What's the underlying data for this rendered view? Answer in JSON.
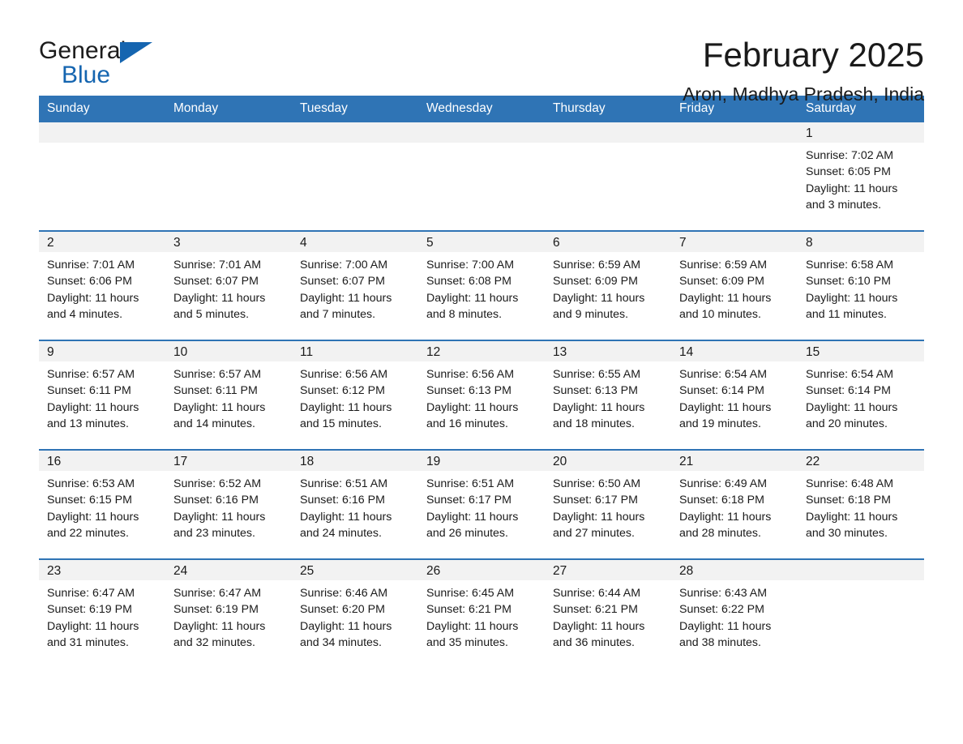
{
  "brand": {
    "name_part1": "General",
    "name_part2": "Blue",
    "triangle_icon": "triangle-icon",
    "accent_color": "#1565b0"
  },
  "header": {
    "month_title": "February 2025",
    "location": "Aron, Madhya Pradesh, India"
  },
  "theme": {
    "header_blue": "#2f74b5",
    "daynum_band": "#f2f2f2",
    "text": "#1a1a1a"
  },
  "calendar": {
    "weekday_headers": [
      "Sunday",
      "Monday",
      "Tuesday",
      "Wednesday",
      "Thursday",
      "Friday",
      "Saturday"
    ],
    "weeks": [
      [
        {
          "blank": true
        },
        {
          "blank": true
        },
        {
          "blank": true
        },
        {
          "blank": true
        },
        {
          "blank": true
        },
        {
          "blank": true
        },
        {
          "day": "1",
          "sunrise": "Sunrise: 7:02 AM",
          "sunset": "Sunset: 6:05 PM",
          "daylight1": "Daylight: 11 hours",
          "daylight2": "and 3 minutes."
        }
      ],
      [
        {
          "day": "2",
          "sunrise": "Sunrise: 7:01 AM",
          "sunset": "Sunset: 6:06 PM",
          "daylight1": "Daylight: 11 hours",
          "daylight2": "and 4 minutes."
        },
        {
          "day": "3",
          "sunrise": "Sunrise: 7:01 AM",
          "sunset": "Sunset: 6:07 PM",
          "daylight1": "Daylight: 11 hours",
          "daylight2": "and 5 minutes."
        },
        {
          "day": "4",
          "sunrise": "Sunrise: 7:00 AM",
          "sunset": "Sunset: 6:07 PM",
          "daylight1": "Daylight: 11 hours",
          "daylight2": "and 7 minutes."
        },
        {
          "day": "5",
          "sunrise": "Sunrise: 7:00 AM",
          "sunset": "Sunset: 6:08 PM",
          "daylight1": "Daylight: 11 hours",
          "daylight2": "and 8 minutes."
        },
        {
          "day": "6",
          "sunrise": "Sunrise: 6:59 AM",
          "sunset": "Sunset: 6:09 PM",
          "daylight1": "Daylight: 11 hours",
          "daylight2": "and 9 minutes."
        },
        {
          "day": "7",
          "sunrise": "Sunrise: 6:59 AM",
          "sunset": "Sunset: 6:09 PM",
          "daylight1": "Daylight: 11 hours",
          "daylight2": "and 10 minutes."
        },
        {
          "day": "8",
          "sunrise": "Sunrise: 6:58 AM",
          "sunset": "Sunset: 6:10 PM",
          "daylight1": "Daylight: 11 hours",
          "daylight2": "and 11 minutes."
        }
      ],
      [
        {
          "day": "9",
          "sunrise": "Sunrise: 6:57 AM",
          "sunset": "Sunset: 6:11 PM",
          "daylight1": "Daylight: 11 hours",
          "daylight2": "and 13 minutes."
        },
        {
          "day": "10",
          "sunrise": "Sunrise: 6:57 AM",
          "sunset": "Sunset: 6:11 PM",
          "daylight1": "Daylight: 11 hours",
          "daylight2": "and 14 minutes."
        },
        {
          "day": "11",
          "sunrise": "Sunrise: 6:56 AM",
          "sunset": "Sunset: 6:12 PM",
          "daylight1": "Daylight: 11 hours",
          "daylight2": "and 15 minutes."
        },
        {
          "day": "12",
          "sunrise": "Sunrise: 6:56 AM",
          "sunset": "Sunset: 6:13 PM",
          "daylight1": "Daylight: 11 hours",
          "daylight2": "and 16 minutes."
        },
        {
          "day": "13",
          "sunrise": "Sunrise: 6:55 AM",
          "sunset": "Sunset: 6:13 PM",
          "daylight1": "Daylight: 11 hours",
          "daylight2": "and 18 minutes."
        },
        {
          "day": "14",
          "sunrise": "Sunrise: 6:54 AM",
          "sunset": "Sunset: 6:14 PM",
          "daylight1": "Daylight: 11 hours",
          "daylight2": "and 19 minutes."
        },
        {
          "day": "15",
          "sunrise": "Sunrise: 6:54 AM",
          "sunset": "Sunset: 6:14 PM",
          "daylight1": "Daylight: 11 hours",
          "daylight2": "and 20 minutes."
        }
      ],
      [
        {
          "day": "16",
          "sunrise": "Sunrise: 6:53 AM",
          "sunset": "Sunset: 6:15 PM",
          "daylight1": "Daylight: 11 hours",
          "daylight2": "and 22 minutes."
        },
        {
          "day": "17",
          "sunrise": "Sunrise: 6:52 AM",
          "sunset": "Sunset: 6:16 PM",
          "daylight1": "Daylight: 11 hours",
          "daylight2": "and 23 minutes."
        },
        {
          "day": "18",
          "sunrise": "Sunrise: 6:51 AM",
          "sunset": "Sunset: 6:16 PM",
          "daylight1": "Daylight: 11 hours",
          "daylight2": "and 24 minutes."
        },
        {
          "day": "19",
          "sunrise": "Sunrise: 6:51 AM",
          "sunset": "Sunset: 6:17 PM",
          "daylight1": "Daylight: 11 hours",
          "daylight2": "and 26 minutes."
        },
        {
          "day": "20",
          "sunrise": "Sunrise: 6:50 AM",
          "sunset": "Sunset: 6:17 PM",
          "daylight1": "Daylight: 11 hours",
          "daylight2": "and 27 minutes."
        },
        {
          "day": "21",
          "sunrise": "Sunrise: 6:49 AM",
          "sunset": "Sunset: 6:18 PM",
          "daylight1": "Daylight: 11 hours",
          "daylight2": "and 28 minutes."
        },
        {
          "day": "22",
          "sunrise": "Sunrise: 6:48 AM",
          "sunset": "Sunset: 6:18 PM",
          "daylight1": "Daylight: 11 hours",
          "daylight2": "and 30 minutes."
        }
      ],
      [
        {
          "day": "23",
          "sunrise": "Sunrise: 6:47 AM",
          "sunset": "Sunset: 6:19 PM",
          "daylight1": "Daylight: 11 hours",
          "daylight2": "and 31 minutes."
        },
        {
          "day": "24",
          "sunrise": "Sunrise: 6:47 AM",
          "sunset": "Sunset: 6:19 PM",
          "daylight1": "Daylight: 11 hours",
          "daylight2": "and 32 minutes."
        },
        {
          "day": "25",
          "sunrise": "Sunrise: 6:46 AM",
          "sunset": "Sunset: 6:20 PM",
          "daylight1": "Daylight: 11 hours",
          "daylight2": "and 34 minutes."
        },
        {
          "day": "26",
          "sunrise": "Sunrise: 6:45 AM",
          "sunset": "Sunset: 6:21 PM",
          "daylight1": "Daylight: 11 hours",
          "daylight2": "and 35 minutes."
        },
        {
          "day": "27",
          "sunrise": "Sunrise: 6:44 AM",
          "sunset": "Sunset: 6:21 PM",
          "daylight1": "Daylight: 11 hours",
          "daylight2": "and 36 minutes."
        },
        {
          "day": "28",
          "sunrise": "Sunrise: 6:43 AM",
          "sunset": "Sunset: 6:22 PM",
          "daylight1": "Daylight: 11 hours",
          "daylight2": "and 38 minutes."
        },
        {
          "blank": true
        }
      ]
    ]
  }
}
